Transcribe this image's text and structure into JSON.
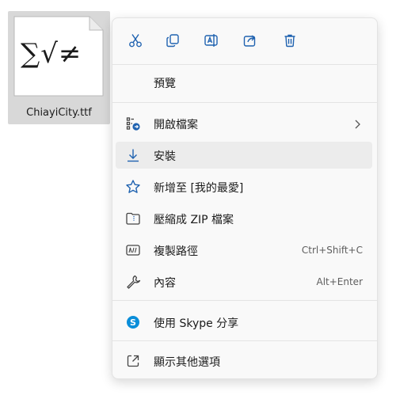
{
  "file": {
    "name": "ChiayiCity.ttf",
    "thumbnail_text": "∑√≠",
    "thumbnail_icon": "font-file-icon"
  },
  "quick_actions": [
    {
      "name": "cut",
      "icon": "scissors-icon"
    },
    {
      "name": "copy",
      "icon": "copy-icon"
    },
    {
      "name": "rename",
      "icon": "rename-icon"
    },
    {
      "name": "share",
      "icon": "share-icon"
    },
    {
      "name": "delete",
      "icon": "trash-icon"
    }
  ],
  "menu": {
    "preview": {
      "label": "預覽"
    },
    "open_with": {
      "label": "開啟檔案",
      "icon": "open-with-icon",
      "has_submenu": true
    },
    "install": {
      "label": "安裝",
      "icon": "download-icon",
      "hovered": true
    },
    "add_favorites": {
      "label": "新增至 [我的最愛]",
      "icon": "star-icon"
    },
    "compress_zip": {
      "label": "壓縮成 ZIP 檔案",
      "icon": "zip-folder-icon"
    },
    "copy_path": {
      "label": "複製路徑",
      "shortcut": "Ctrl+Shift+C",
      "icon": "copy-path-icon"
    },
    "properties": {
      "label": "內容",
      "shortcut": "Alt+Enter",
      "icon": "wrench-icon"
    },
    "skype_share": {
      "label": "使用 Skype 分享",
      "icon": "skype-icon"
    },
    "more_options": {
      "label": "顯示其他選項",
      "icon": "external-link-icon"
    }
  },
  "colors": {
    "accent": "#1f62b0",
    "skype": "#0a8ed9",
    "menu_bg": "#f9f9f9",
    "hover_bg": "#ececec",
    "tile_bg": "#d8d8d8"
  }
}
